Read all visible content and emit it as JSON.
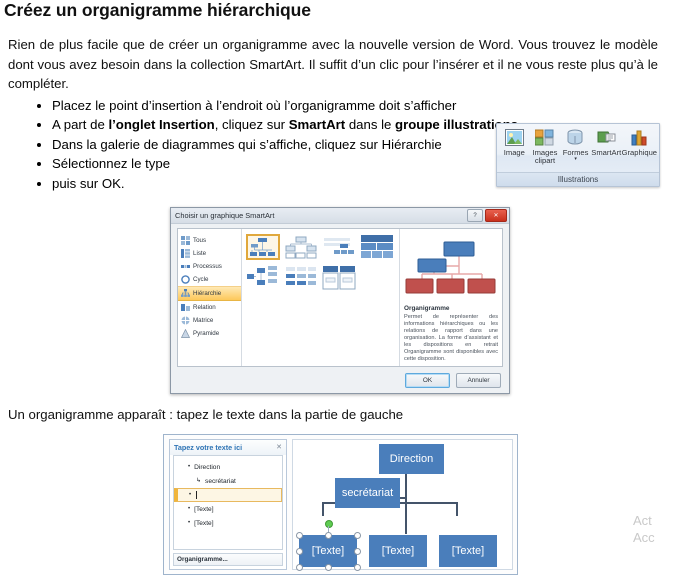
{
  "document": {
    "title": "Créez un organigramme hiérarchique",
    "intro": "Rien de plus facile que de créer un organigramme avec la nouvelle version de Word. Vous trouvez le modèle dont vous avez besoin dans la collection SmartArt. Il suffit d’un clic pour l’insérer et il ne vous reste plus qu’à le compléter.",
    "steps": [
      {
        "text_before": "Placez le point d’insertion à l’endroit où l’organigramme doit s’afficher"
      },
      {
        "text_before": "A part de ",
        "bold1": "l’onglet Insertion",
        "text_mid1": ", cliquez sur ",
        "bold2": "SmartArt",
        "text_mid2": " dans le ",
        "bold3": "groupe illustrations"
      },
      {
        "text_before": "Dans la galerie de diagrammes qui s’affiche, cliquez sur Hiérarchie"
      },
      {
        "text_before": "Sélectionnez le type"
      },
      {
        "text_before": "puis sur OK."
      }
    ],
    "caption2": "Un organigramme apparaît : tapez le texte dans la partie de gauche"
  },
  "ribbon": {
    "group_label": "Illustrations",
    "buttons": [
      {
        "label": "Image",
        "icon": "picture-icon",
        "has_arrow": false
      },
      {
        "label": "Images\nclipart",
        "icon": "clipart-icon",
        "has_arrow": false
      },
      {
        "label": "Formes",
        "icon": "shapes-icon",
        "has_arrow": true,
        "arrow": "▾"
      },
      {
        "label": "SmartArt",
        "icon": "smartart-icon",
        "has_arrow": false
      },
      {
        "label": "Graphique",
        "icon": "chart-icon",
        "has_arrow": false
      }
    ]
  },
  "dialog": {
    "title": "Choisir un graphique SmartArt",
    "help_label": "?",
    "close_label": "✕",
    "categories": [
      {
        "label": "Tous",
        "icon": "all-icon",
        "active": false
      },
      {
        "label": "Liste",
        "icon": "list-icon",
        "active": false
      },
      {
        "label": "Processus",
        "icon": "process-icon",
        "active": false
      },
      {
        "label": "Cycle",
        "icon": "cycle-icon",
        "active": false
      },
      {
        "label": "Hiérarchie",
        "icon": "hierarchy-icon",
        "active": true
      },
      {
        "label": "Relation",
        "icon": "relation-icon",
        "active": false
      },
      {
        "label": "Matrice",
        "icon": "matrix-icon",
        "active": false
      },
      {
        "label": "Pyramide",
        "icon": "pyramid-icon",
        "active": false
      }
    ],
    "gallery": {
      "row1_count": 4,
      "row2_count": 3,
      "selected_index": 0
    },
    "preview": {
      "name": "Organigramme",
      "description": "Permet de représenter des informations hiérarchiques ou les relations de rapport dans une organisation. La forme d’assistant et les dispositions en retrait Organigramme sont disponibles avec cette disposition."
    },
    "buttons": {
      "ok": "OK",
      "cancel": "Annuler"
    }
  },
  "editor": {
    "text_pane": {
      "title": "Tapez votre texte ici",
      "close_label": "✕",
      "rows": [
        {
          "label": "Direction",
          "level": 1,
          "bullet": "•",
          "active": false
        },
        {
          "label": "secrétariat",
          "level": 2,
          "bullet": "↳",
          "active": false
        },
        {
          "label": "",
          "level": 1,
          "bullet": "•",
          "active": true
        },
        {
          "label": "[Texte]",
          "level": 1,
          "bullet": "•",
          "active": false
        },
        {
          "label": "[Texte]",
          "level": 1,
          "bullet": "•",
          "active": false
        }
      ],
      "footer": "Organigramme..."
    },
    "diagram": {
      "node_color": "#4a7ebb",
      "nodes": [
        {
          "label": "Direction",
          "role": "root"
        },
        {
          "label": "secrétariat",
          "role": "assistant"
        },
        {
          "label": "[Texte]",
          "role": "child",
          "selected": true
        },
        {
          "label": "[Texte]",
          "role": "child",
          "selected": false
        },
        {
          "label": "[Texte]",
          "role": "child",
          "selected": false
        }
      ]
    }
  },
  "watermark": {
    "line1": "Act",
    "line2": "Acc"
  }
}
